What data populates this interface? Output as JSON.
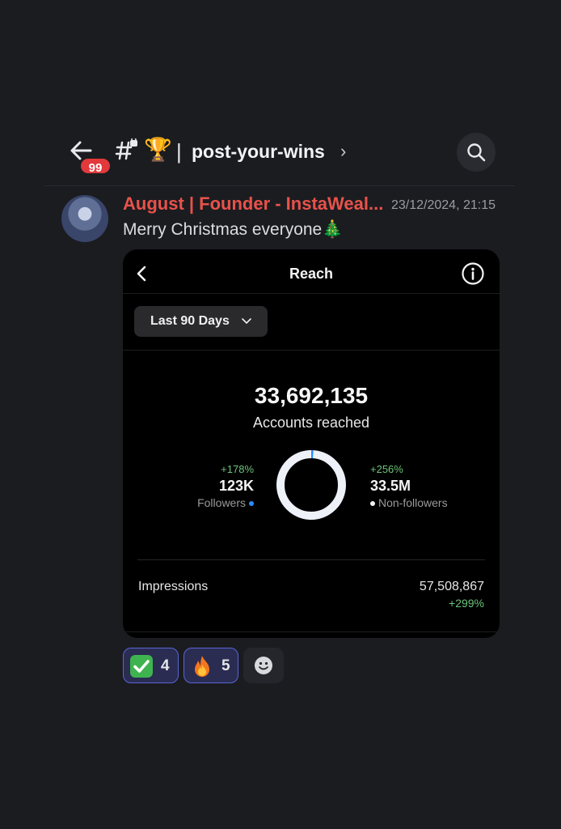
{
  "header": {
    "unread_badge": "99",
    "channel_emoji": "🏆",
    "separator": "|",
    "channel_name": "post-your-wins",
    "chevron": "›"
  },
  "message": {
    "author": "August | Founder - InstaWeal...",
    "author_color": "#e9524a",
    "timestamp": "23/12/2024, 21:15",
    "text": "Merry Christmas everyone🎄"
  },
  "embed": {
    "title": "Reach",
    "range_label": "Last 90 Days",
    "accounts_reached_value": "33,692,135",
    "accounts_reached_label": "Accounts reached",
    "followers": {
      "change": "+178%",
      "value": "123K",
      "label": "Followers"
    },
    "non_followers": {
      "change": "+256%",
      "value": "33.5M",
      "label": "Non-followers"
    },
    "donut_follower_share": 0.004,
    "impressions": {
      "label": "Impressions",
      "value": "57,508,867",
      "change": "+299%"
    }
  },
  "reactions": [
    {
      "emoji": "check-mark-icon",
      "count": "4"
    },
    {
      "emoji": "fire-icon",
      "count": "5"
    }
  ]
}
